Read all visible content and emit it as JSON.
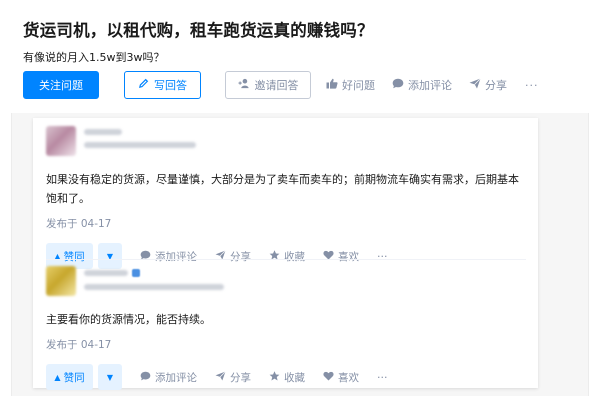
{
  "question": {
    "title": "货运司机，以租代购，租车跑货运真的赚钱吗？",
    "detail": "有像说的月入1.5w到3w吗？"
  },
  "question_actions": {
    "follow_label": "关注问题",
    "write_answer_label": "写回答",
    "invite_label": "邀请回答",
    "good_question_label": "好问题",
    "comment_label": "添加评论",
    "share_label": "分享",
    "more_label": "···",
    "icons": {
      "write": "pencil-icon",
      "invite": "add-user-icon",
      "good": "thumbs-up-icon",
      "comment": "comment-bubble-icon",
      "share": "paper-plane-icon"
    }
  },
  "answers": [
    {
      "text": "如果没有稳定的货源，尽量谨慎，大部分是为了卖车而卖车的；前期物流车确实有需求，后期基本饱和了。",
      "date": "发布于 04-17",
      "upvote_label": "赞同",
      "comment_label": "添加评论",
      "share_label": "分享",
      "collect_label": "收藏",
      "like_label": "喜欢",
      "more_label": "···"
    },
    {
      "text": "主要看你的货源情况，能否持续。",
      "date": "发布于 04-17",
      "upvote_label": "赞同",
      "comment_label": "添加评论",
      "share_label": "分享",
      "collect_label": "收藏",
      "like_label": "喜欢",
      "more_label": "···"
    }
  ],
  "colors": {
    "accent": "#0084ff",
    "muted": "#8590a6",
    "upvote_bg": "#e5f2ff",
    "page_bg": "#f6f6f6"
  }
}
